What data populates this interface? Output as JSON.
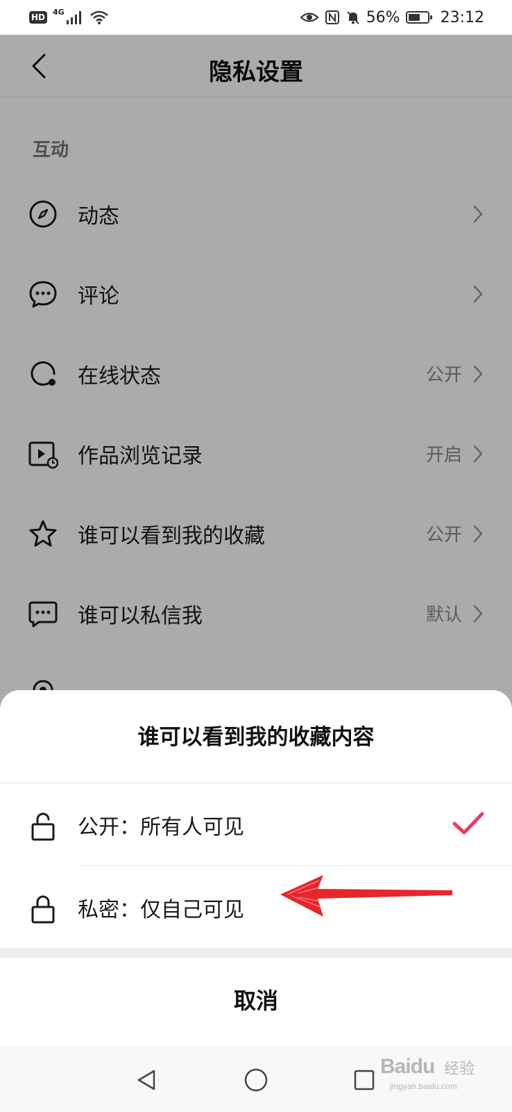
{
  "status_bar": {
    "hd_badge": "HD",
    "network_type": "4G",
    "battery_percent": "56%",
    "time": "23:12",
    "icons": [
      "signal-icon",
      "wifi-icon",
      "eye-icon",
      "nfc-icon",
      "mute-bell-icon",
      "battery-icon"
    ]
  },
  "header": {
    "title": "隐私设置",
    "back_icon": "back-chevron-icon"
  },
  "section": {
    "title": "互动"
  },
  "settings": [
    {
      "label": "动态",
      "value": "",
      "icon": "compass-icon"
    },
    {
      "label": "评论",
      "value": "",
      "icon": "comment-bubble-icon"
    },
    {
      "label": "在线状态",
      "value": "公开",
      "icon": "online-status-icon"
    },
    {
      "label": "作品浏览记录",
      "value": "开启",
      "icon": "video-history-icon"
    },
    {
      "label": "谁可以看到我的收藏",
      "value": "公开",
      "icon": "star-icon"
    },
    {
      "label": "谁可以私信我",
      "value": "默认",
      "icon": "message-icon"
    }
  ],
  "sheet": {
    "title": "谁可以看到我的收藏内容",
    "options": [
      {
        "label": "公开：所有人可见",
        "icon": "unlock-icon",
        "selected": true
      },
      {
        "label": "私密：仅自己可见",
        "icon": "lock-icon",
        "selected": false
      }
    ],
    "cancel_label": "取消"
  },
  "colors": {
    "accent_check": "#ef3b5c",
    "annotation_arrow": "#e8262a",
    "overlay": "rgba(0,0,0,0.33)"
  },
  "nav_bar": {
    "icons": [
      "nav-back-icon",
      "nav-home-icon",
      "nav-recent-icon"
    ]
  },
  "watermark": {
    "brand": "Baidu",
    "cn": "经验",
    "url": "jingyan.baidu.com"
  }
}
